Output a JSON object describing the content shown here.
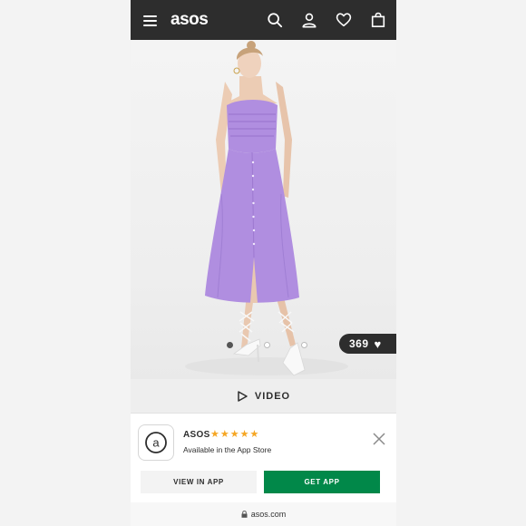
{
  "header": {
    "logo_text": "asos",
    "background": "#2d2d2d",
    "icons": [
      "menu-icon",
      "search-icon",
      "account-icon",
      "wishlist-heart-icon",
      "bag-icon"
    ]
  },
  "product": {
    "dress_color": "#b08ee0",
    "carousel": {
      "total": 3,
      "active_index": 0
    },
    "like_count": "369"
  },
  "video": {
    "label": "VIDEO"
  },
  "app_banner": {
    "app_name": "ASOS",
    "stars": "★★★★★",
    "rating_color": "#f5a623",
    "subtitle": "Available in the App Store",
    "view_in_app": "VIEW IN APP",
    "get_app": "GET APP",
    "get_app_color": "#018849"
  },
  "browser": {
    "url": "asos.com"
  }
}
